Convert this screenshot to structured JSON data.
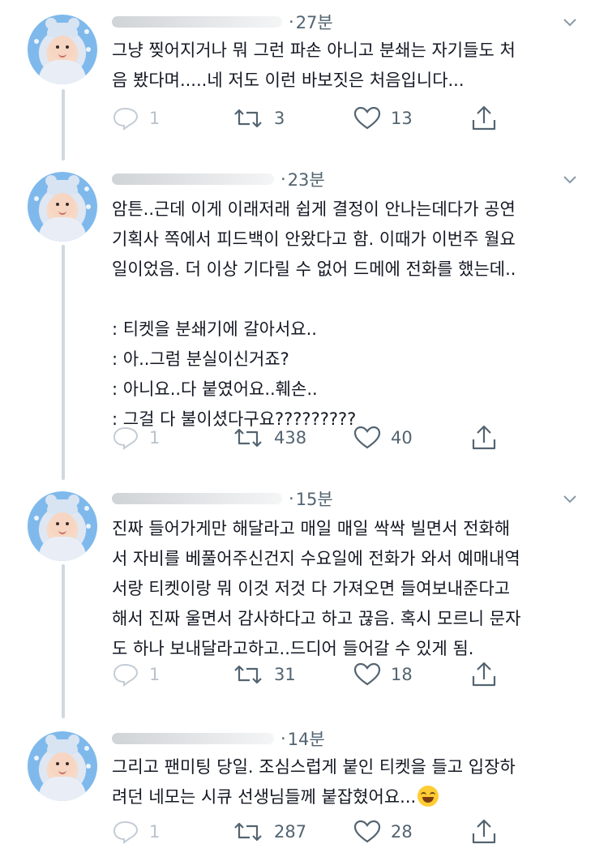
{
  "tweets": [
    {
      "time": "27분",
      "text": "그냥 찢어지거나 뭐 그런 파손 아니고 분쇄는 자기들도 처\n음 봤다며.....네 저도 이런 바보짓은 처음입니다...",
      "reply_count": "1",
      "retweet_count": "3",
      "like_count": "13"
    },
    {
      "time": "23분",
      "text": "암튼..근데 이게 이래저래 쉽게 결정이 안나는데다가 공연\n기획사 쪽에서 피드백이 안왔다고 함. 이때가 이번주 월요\n일이었음. 더 이상 기다릴 수 없어 드메에 전화를 했는데..\n\n: 티켓을 분쇄기에 갈아서요..\n: 아..그럼 분실이신거죠?\n: 아니요..다 붙였어요..훼손..\n: 그걸 다 불이셨다구요?????????",
      "reply_count": "1",
      "retweet_count": "438",
      "like_count": "40"
    },
    {
      "time": "15분",
      "text": "진짜 들어가게만 해달라고 매일 매일 싹싹 빌면서 전화해\n서 자비를 베풀어주신건지 수요일에 전화가 와서 예매내역\n서랑 티켓이랑 뭐 이것 저것 다 가져오면 들여보내준다고\n해서 진짜 울면서 감사하다고 하고 끊음. 혹시 모르니 문자\n도 하나 보내달라고하고..드디어 들어갈 수 있게 됨.",
      "reply_count": "1",
      "retweet_count": "31",
      "like_count": "18"
    },
    {
      "time": "14분",
      "text": "그리고 팬미팅 당일. 조심스럽게 붙인 티켓을 들고 입장하\n려던 네모는 시큐 선생님들께 붙잡혔어요...",
      "reply_count": "1",
      "retweet_count": "287",
      "like_count": "28"
    }
  ],
  "icons": {
    "reply": "reply-bubble-icon",
    "retweet": "retweet-icon",
    "like": "heart-icon",
    "share": "share-icon",
    "more": "chevron-down-icon",
    "emoji": "grinning-squint-emoji"
  },
  "colors": {
    "text": "#141823",
    "muted": "#536471",
    "thread_line": "#cfd9de",
    "avatar_bg": "#7fb9ec"
  }
}
